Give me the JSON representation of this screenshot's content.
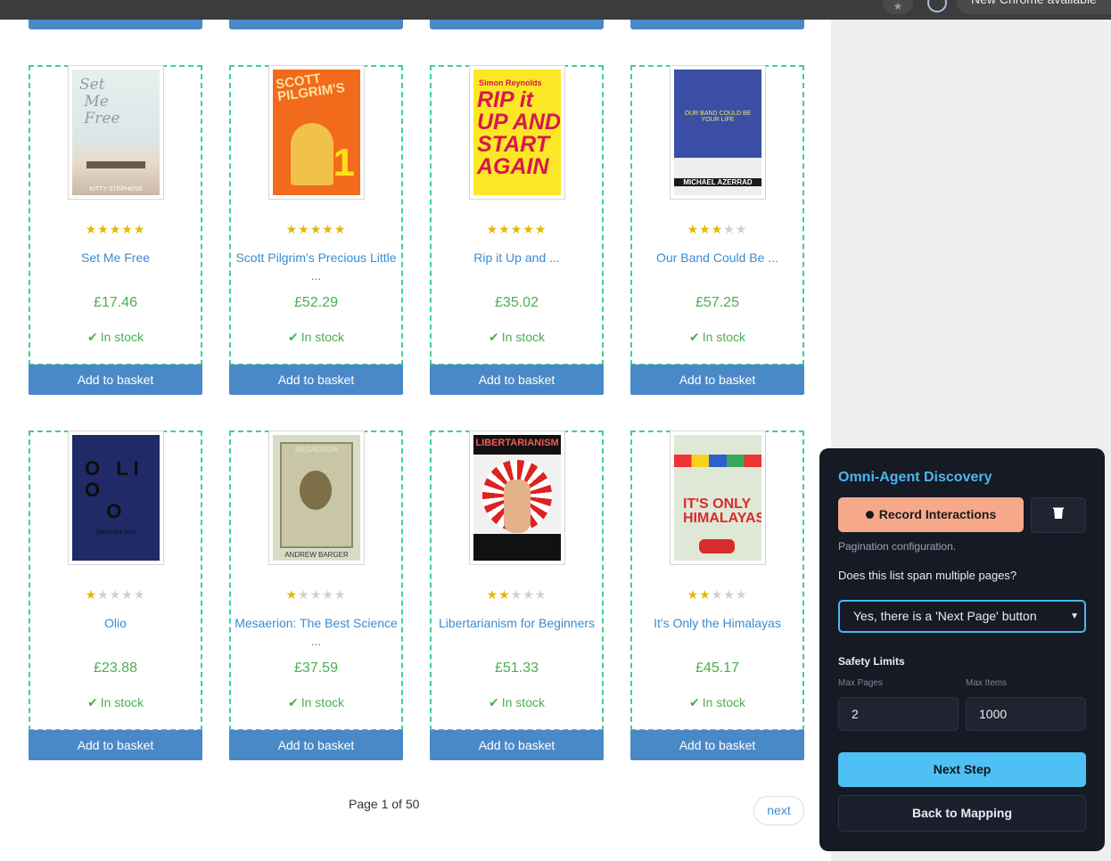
{
  "browser": {
    "update_label": "New Chrome available"
  },
  "products": [
    {
      "title": "Set Me Free",
      "price": "£17.46",
      "stock": "In stock",
      "rating": 5,
      "basket_label": "Add to basket",
      "cover": {
        "title": "Set Me Free",
        "author": "KITTY STEPHENS"
      }
    },
    {
      "title": "Scott Pilgrim's Precious Little ...",
      "price": "£52.29",
      "stock": "In stock",
      "rating": 5,
      "basket_label": "Add to basket",
      "cover": {
        "title": "SCOTT PILGRIM'S",
        "number": "1"
      }
    },
    {
      "title": "Rip it Up and ...",
      "price": "£35.02",
      "stock": "In stock",
      "rating": 5,
      "basket_label": "Add to basket",
      "cover": {
        "title": "RIP it UP AND START AGAIN",
        "author": "Simon Reynolds"
      }
    },
    {
      "title": "Our Band Could Be ...",
      "price": "£57.25",
      "stock": "In stock",
      "rating": 3,
      "basket_label": "Add to basket",
      "cover": {
        "title": "OUR BAND COULD BE YOUR LIFE",
        "author": "MICHAEL AZERRAD"
      }
    },
    {
      "title": "Olio",
      "price": "£23.88",
      "stock": "In stock",
      "rating": 1,
      "basket_label": "Add to basket",
      "cover": {
        "title": "O LI O O",
        "author": "Tyehimba Jess"
      }
    },
    {
      "title": "Mesaerion: The Best Science ...",
      "price": "£37.59",
      "stock": "In stock",
      "rating": 1,
      "basket_label": "Add to basket",
      "cover": {
        "title": "MESAERION",
        "author": "ANDREW BARGER"
      }
    },
    {
      "title": "Libertarianism for Beginners",
      "price": "£51.33",
      "stock": "In stock",
      "rating": 2,
      "basket_label": "Add to basket",
      "cover": {
        "title": "LIBERTARIANISM"
      }
    },
    {
      "title": "It's Only the Himalayas",
      "price": "£45.17",
      "stock": "In stock",
      "rating": 2,
      "basket_label": "Add to basket",
      "cover": {
        "title": "IT'S ONLY THE HIMALAYAS"
      }
    }
  ],
  "pagination": {
    "current": "Page 1 of 50",
    "next_label": "next"
  },
  "agent_panel": {
    "title": "Omni-Agent Discovery",
    "record_label": "Record Interactions",
    "trash_icon": "trash-icon",
    "section_label": "Pagination configuration.",
    "question": "Does this list span multiple pages?",
    "select_value": "Yes, there is a 'Next Page' button",
    "safety_title": "Safety Limits",
    "max_pages_label": "Max Pages",
    "max_pages_value": "2",
    "max_items_label": "Max Items",
    "max_items_value": "1000",
    "next_step_label": "Next Step",
    "back_label": "Back to Mapping"
  },
  "colors": {
    "accent_blue": "#4a89c8",
    "price_green": "#4bae4f",
    "dashed_border": "#3bd19a",
    "agent_bg": "#161a24",
    "record_bg": "#f6a98a",
    "next_step_bg": "#4fc0f4"
  }
}
